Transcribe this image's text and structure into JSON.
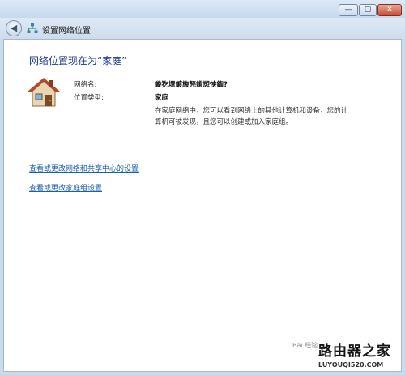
{
  "window": {
    "title_buttons": {
      "minimize": "—",
      "maximize": "▢",
      "close": "✕"
    },
    "back_icon": "back-arrow-icon"
  },
  "address": {
    "breadcrumb": "设置网络位置",
    "icon": "network-icon"
  },
  "main": {
    "heading": "网络位置现在为“家庭”",
    "icon": "house-icon",
    "network_name_label": "网络名:",
    "network_name_value": "鏇犵墿鍍旇棾鎻愬悏鍧?",
    "location_type_label": "位置类型:",
    "location_type_value": "家庭",
    "description": "在家庭网络中，您可以看到网络上的其他计算机和设备，您的计算机可被发现，且您可以创建或加入家庭组。",
    "links": {
      "network_center": "查看或更改网络和共享中心的设置",
      "homegroup": "查看或更改家庭组设置"
    }
  },
  "watermark": {
    "brand": "路由器之家",
    "url": "LUYOUQI520.COM",
    "baidu": "Bai 经验"
  },
  "colors": {
    "heading": "#1e3b8a",
    "link": "#1a5fb4",
    "chrome": "#c9dcee",
    "close_button": "#c94b33"
  }
}
